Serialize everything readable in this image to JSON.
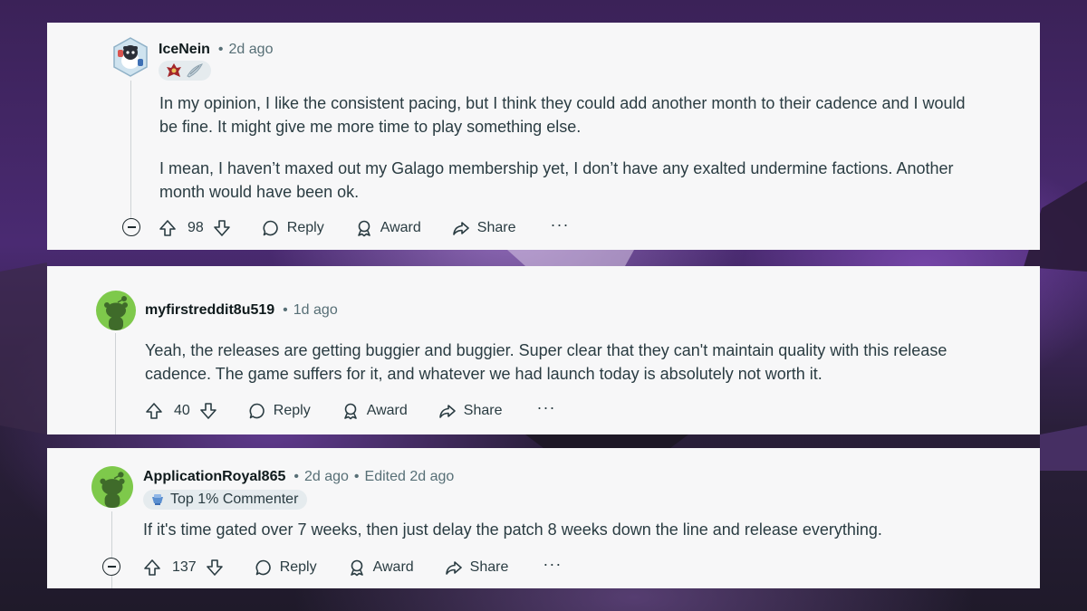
{
  "comments": [
    {
      "username": "IceNein",
      "time": "2d ago",
      "paragraphs": [
        "In my opinion, I like the consistent pacing, but I think they could add another month to their cadence and I would be fine. It might give me more time to play something else.",
        "I mean, I haven’t maxed out my Galago membership yet, I don’t have any exalted undermine factions. Another month would have been ok."
      ],
      "votes": "98",
      "reply_label": "Reply",
      "award_label": "Award",
      "share_label": "Share",
      "more_label": "···"
    },
    {
      "username": "myfirstreddit8u519",
      "time": "1d ago",
      "paragraphs": [
        "Yeah, the releases are getting buggier and buggier. Super clear that they can't maintain quality with this release cadence. The game suffers for it, and whatever we had launch today is absolutely not worth it."
      ],
      "votes": "40",
      "reply_label": "Reply",
      "award_label": "Award",
      "share_label": "Share",
      "more_label": "···"
    },
    {
      "username": "ApplicationRoyal865",
      "time": "2d ago",
      "edited": "Edited 2d ago",
      "flair": "Top 1% Commenter",
      "paragraphs": [
        "If it's time gated over 7 weeks, then just delay the patch 8 weeks down the line and release everything."
      ],
      "votes": "137",
      "reply_label": "Reply",
      "award_label": "Award",
      "share_label": "Share",
      "more_label": "···"
    }
  ],
  "colors": {
    "card_bg": "#f7f7f8",
    "text": "#2a3c42",
    "meta": "#576f76",
    "avatar_green": "#7ec94b"
  }
}
